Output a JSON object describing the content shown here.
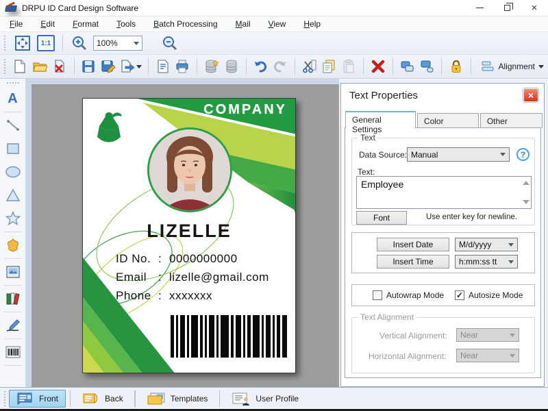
{
  "window": {
    "title": "DRPU ID Card Design Software"
  },
  "menu": {
    "items": [
      {
        "label": "File"
      },
      {
        "label": "Edit"
      },
      {
        "label": "Format"
      },
      {
        "label": "Tools"
      },
      {
        "label": "Batch Processing"
      },
      {
        "label": "Mail"
      },
      {
        "label": "View"
      },
      {
        "label": "Help"
      }
    ]
  },
  "toolbar": {
    "zoom_value": "100%",
    "actual_size_label": "1:1",
    "alignment_label": "Alignment"
  },
  "tools": {
    "text_tool_glyph": "A"
  },
  "card": {
    "company_name": "COMPANY",
    "holder_name": "LIZELLE",
    "fields": [
      {
        "label": "ID No.",
        "separator": ":",
        "value": "0000000000"
      },
      {
        "label": "Email",
        "separator": ":",
        "value": "lizelle@gmail.com"
      },
      {
        "label": "Phone",
        "separator": ":",
        "value": "xxxxxxx"
      }
    ]
  },
  "panel": {
    "title": "Text Properties",
    "tabs": [
      {
        "label": "General Settings"
      },
      {
        "label": "Color Settings"
      },
      {
        "label": "Other Settings"
      }
    ],
    "text_group": {
      "legend": "Text",
      "data_source_label": "Data Source:",
      "data_source_value": "Manual",
      "help_glyph": "?",
      "text_label": "Text:",
      "text_value": "Employee",
      "font_button_label": "Font",
      "newline_hint": "Use enter key for newline."
    },
    "insert_group": {
      "insert_date_label": "Insert Date",
      "date_format_value": "M/d/yyyy",
      "insert_time_label": "Insert Time",
      "time_format_value": "h:mm:ss tt"
    },
    "mode_group": {
      "autowrap_label": "Autowrap Mode",
      "autosize_label": "Autosize Mode",
      "autosize_checkmark": "✓"
    },
    "alignment_group": {
      "legend": "Text Alignment",
      "vertical_label": "Vertical Alignment:",
      "vertical_value": "Near",
      "horizontal_label": "Horizontal Alignment:",
      "horizontal_value": "Near"
    }
  },
  "bottombar": {
    "buttons": [
      {
        "label": "Front"
      },
      {
        "label": "Back"
      },
      {
        "label": "Templates"
      },
      {
        "label": "User Profile"
      }
    ]
  },
  "colors": {
    "accent_green": "#219a41",
    "accent_blue": "#2f7fc0",
    "close_red": "#d3331d",
    "front_active": "#9fd4f2"
  }
}
